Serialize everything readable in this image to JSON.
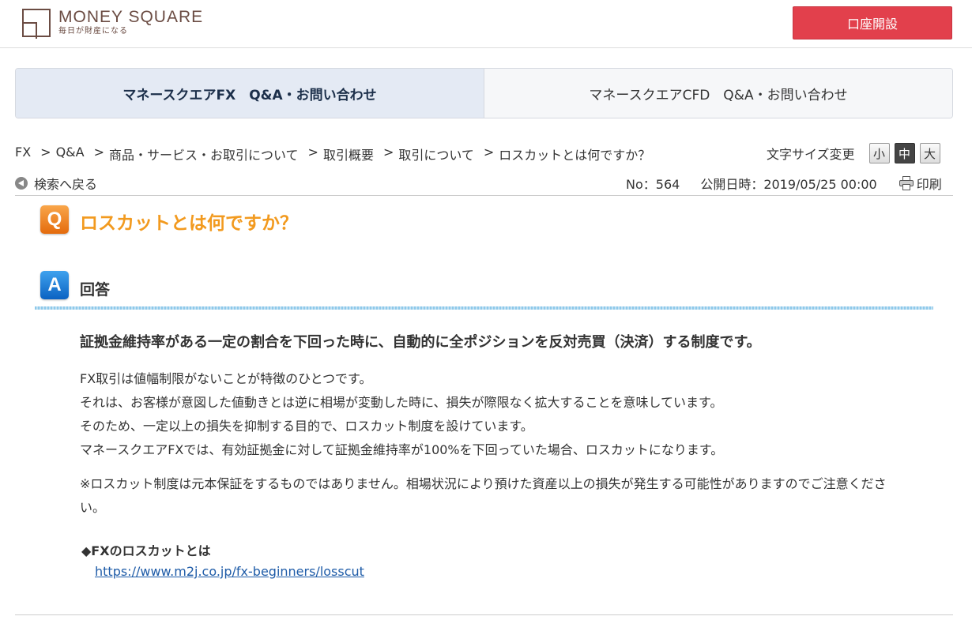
{
  "header": {
    "logo_name": "MONEY SQUARE",
    "logo_tagline": "毎日が財産になる",
    "open_account_label": "口座開設"
  },
  "tabs": [
    {
      "label": "マネースクエアFX　Q&A・お問い合わせ",
      "active": true
    },
    {
      "label": "マネースクエアCFD　Q&A・お問い合わせ",
      "active": false
    }
  ],
  "breadcrumb": {
    "separator": ">",
    "items": [
      "FX",
      "Q&A",
      "商品・サービス・お取引について",
      "取引概要",
      "取引について"
    ],
    "current": "ロスカットとは何ですか？"
  },
  "font_size": {
    "label": "文字サイズ変更",
    "options": [
      "小",
      "中",
      "大"
    ],
    "selected": "中"
  },
  "back_label": "検索へ戻る",
  "meta": {
    "number": "No：564",
    "published": "公開日時：2019/05/25 00:00",
    "print_label": "印刷"
  },
  "question": {
    "badge": "Q",
    "title": "ロスカットとは何ですか？"
  },
  "answer": {
    "badge": "A",
    "heading": "回答",
    "lead": "証拠金維持率がある一定の割合を下回った時に、自動的に全ポジションを反対売買（決済）する制度です。",
    "lines": [
      "FX取引は値幅制限がないことが特徴のひとつです。",
      "それは、お客様が意図した値動きとは逆に相場が変動した時に、損失が際限なく拡大することを意味しています。",
      "そのため、一定以上の損失を抑制する目的で、ロスカット制度を設けています。",
      "マネースクエアFXでは、有効証拠金に対して証拠金維持率が100%を下回っていた場合、ロスカットになります。"
    ],
    "note": "※ロスカット制度は元本保証をするものではありません。相場状況により預けた資産以上の損失が発生する可能性がありますのでご注意ください。",
    "link_title": "◆FXのロスカットとは",
    "link_url": "https://www.m2j.co.jp/fx-beginners/losscut"
  },
  "colors": {
    "brand": "#6b4c43",
    "open_button": "#e2404c",
    "question": "#f29a1f",
    "answer_badge": "#0b62c2",
    "link": "#1f5ca8"
  }
}
